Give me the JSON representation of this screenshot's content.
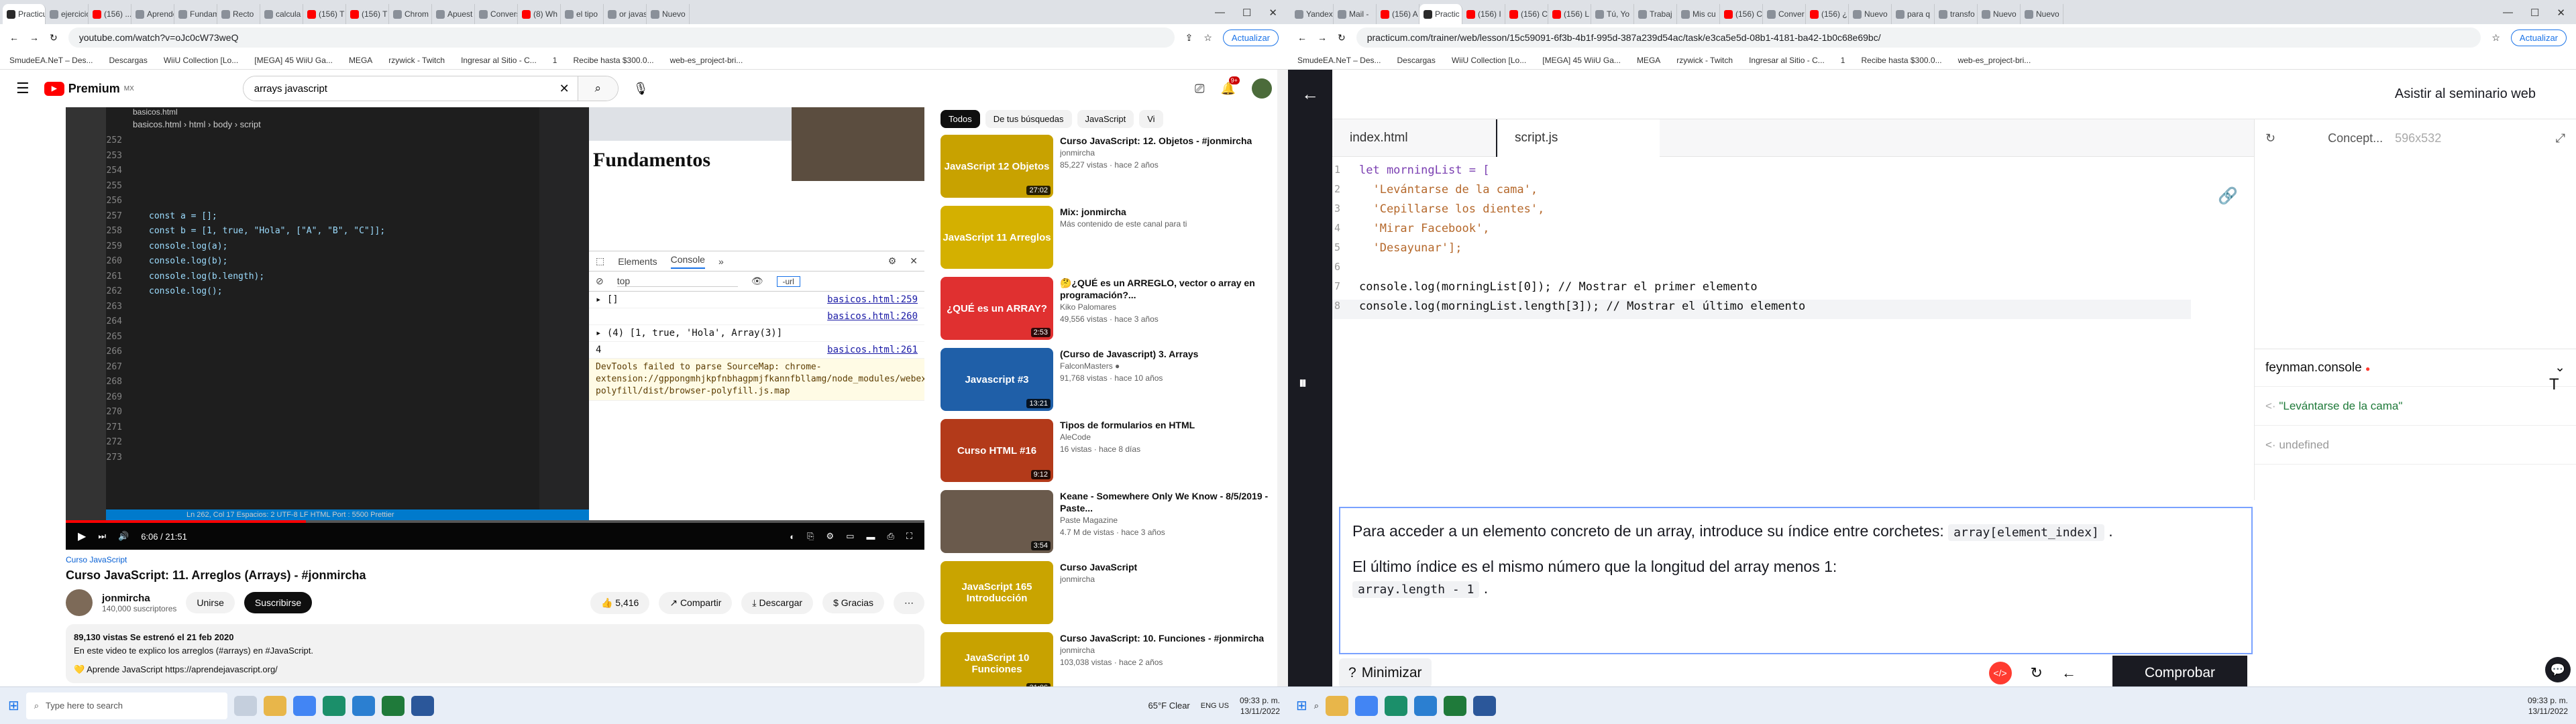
{
  "left": {
    "tabs": [
      "Practicu",
      "ejercicio",
      "(156) ...",
      "Aprende",
      "Fundam",
      "Recto",
      "calcula",
      "(156) T",
      "(156) T",
      "Chrom",
      "Apuest",
      "Convers",
      "(8) Wh",
      "el tipo",
      "or javas",
      "Nuevo"
    ],
    "url": "youtube.com/watch?v=oJc0cW73weQ",
    "update_label": "Actualizar",
    "bookmarks": [
      "SmudeEA.NeT – Des...",
      "Descargas",
      "WiiU Collection [Lo...",
      "[MEGA] 45 WiiU Ga...",
      "MEGA",
      "rzywick - Twitch",
      "Ingresar al Sitio - C...",
      "1",
      "Recibe hasta $300.0...",
      "web-es_project-bri..."
    ],
    "yt": {
      "logo": "Premium",
      "region": "MX",
      "search_value": "arrays javascript",
      "notif_count": "9+"
    },
    "vscode": {
      "title": "basicos.html",
      "crumb": "basicos.html › html › body › script",
      "lines": [
        {
          "n": "252",
          "t": ""
        },
        {
          "n": "253",
          "t": ""
        },
        {
          "n": "254",
          "t": ""
        },
        {
          "n": "255",
          "t": ""
        },
        {
          "n": "256",
          "t": ""
        },
        {
          "n": "257",
          "t": "const a = [];"
        },
        {
          "n": "258",
          "t": "const b = [1, true, \"Hola\", [\"A\", \"B\", \"C\"]];"
        },
        {
          "n": "259",
          "t": "console.log(a);"
        },
        {
          "n": "260",
          "t": "console.log(b);"
        },
        {
          "n": "261",
          "t": "console.log(b.length);"
        },
        {
          "n": "262",
          "t": "console.log();"
        },
        {
          "n": "263",
          "t": ""
        },
        {
          "n": "264",
          "t": ""
        },
        {
          "n": "265",
          "t": ""
        },
        {
          "n": "266",
          "t": ""
        },
        {
          "n": "267",
          "t": ""
        },
        {
          "n": "268",
          "t": ""
        },
        {
          "n": "269",
          "t": ""
        },
        {
          "n": "270",
          "t": ""
        },
        {
          "n": "271",
          "t": ""
        },
        {
          "n": "272",
          "t": ""
        },
        {
          "n": "273",
          "t": ""
        }
      ],
      "status": "Ln 262, Col 17   Espacios: 2   UTF-8   LF   HTML   Port : 5500   Prettier"
    },
    "page": {
      "heading": "Fundamentos"
    },
    "devtools": {
      "tabs": [
        "Elements",
        "Console"
      ],
      "context": "top",
      "filter": "-url",
      "lines": [
        {
          "text": "▸ []",
          "src": "basicos.html:259"
        },
        {
          "text": "",
          "src": "basicos.html:260"
        },
        {
          "text": "▸ (4) [1, true, 'Hola', Array(3)]",
          "src": ""
        },
        {
          "text": "4",
          "src": "basicos.html:261"
        }
      ],
      "warning": "DevTools failed to parse SourceMap: chrome-extension://gppongmhjkpfnbhagpmjfkannfbllamg/node_modules/webextension-polyfill/dist/browser-polyfill.js.map"
    },
    "player": {
      "time": "6:06 / 21:51",
      "progress": 0.28
    },
    "video": {
      "playlist": "Curso JavaScript",
      "title": "Curso JavaScript: 11. Arreglos (Arrays) - #jonmircha",
      "channel": "jonmircha",
      "subs": "140,000 suscriptores",
      "join": "Unirse",
      "subscribe": "Suscribirse",
      "likes": "5,416",
      "share": "Compartir",
      "download": "Descargar",
      "thanks": "Gracias",
      "views": "89,130 vistas  Se estrenó el 21 feb 2020",
      "desc1": "En este video te explico los arreglos (#arrays) en #JavaScript.",
      "desc2": "💛 Aprende JavaScript https://aprendejavascript.org/"
    },
    "chips": [
      "Todos",
      "De tus búsquedas",
      "JavaScript",
      "Vi"
    ],
    "sidebar": [
      {
        "thumb": "JavaScript 12 Objetos",
        "dur": "27:02",
        "title": "Curso JavaScript: 12. Objetos - #jonmircha",
        "channel": "jonmircha",
        "meta": "85,227 vistas · hace 2 años",
        "color": "#c8a200"
      },
      {
        "thumb": "JavaScript 11 Arreglos",
        "dur": "",
        "title": "Mix: jonmircha",
        "channel": "Más contenido de este canal para ti",
        "meta": "",
        "color": "#d4b000"
      },
      {
        "thumb": "¿QUÉ es un ARRAY?",
        "dur": "2:53",
        "title": "🤔¿QUÉ es un ARREGLO, vector o array en programación?...",
        "channel": "Kiko Palomares",
        "meta": "49,556 vistas · hace 3 años",
        "color": "#e03030"
      },
      {
        "thumb": "Javascript #3",
        "dur": "13:21",
        "title": "(Curso de Javascript) 3. Arrays",
        "channel": "FalconMasters ●",
        "meta": "91,768 vistas · hace 10 años",
        "color": "#1f5fa8"
      },
      {
        "thumb": "Curso HTML #16",
        "dur": "9:12",
        "title": "Tipos de formularios en HTML",
        "channel": "AleCode",
        "meta": "16 vistas · hace 8 días",
        "color": "#b33a1a"
      },
      {
        "thumb": "",
        "dur": "3:54",
        "title": "Keane - Somewhere Only We Know - 8/5/2019 - Paste...",
        "channel": "Paste Magazine",
        "meta": "4.7 M de vistas · hace 3 años",
        "color": "#6a5a4c"
      },
      {
        "thumb": "JavaScript 165 Introducción",
        "dur": "",
        "title": "Curso JavaScript",
        "channel": "jonmircha",
        "meta": "",
        "color": "#c9a400"
      },
      {
        "thumb": "JavaScript 10 Funciones",
        "dur": "31:06",
        "title": "Curso JavaScript: 10. Funciones - #jonmircha",
        "channel": "jonmircha",
        "meta": "103,038 vistas · hace 2 años",
        "color": "#c8a200"
      }
    ],
    "taskbar": {
      "search": "Type here to search",
      "weather": "65°F  Clear",
      "lang": "ENG US",
      "time": "09:33 p. m.",
      "date": "13/11/2022"
    }
  },
  "right": {
    "tabs": [
      "Yandex",
      "Mail -",
      "(156) A",
      "Practic",
      "(156) I",
      "(156) C",
      "(156) L",
      "Tú, Yo",
      "Trabaj",
      "Mis cu",
      "(156) C",
      "Conver",
      "(156) ¿",
      "Nuevo",
      "para q",
      "transfo",
      "Nuevo",
      "Nuevo"
    ],
    "url": "practicum.com/trainer/web/lesson/15c59091-6f3b-4b1f-995d-387a239d54ac/task/e3ca5e5d-08b1-4181-ba42-1b0c68e69bc/",
    "update_label": "Actualizar",
    "header_title": "Asistir al seminario web",
    "file_tabs": [
      "index.html",
      "script.js"
    ],
    "code_lines": [
      {
        "n": "1",
        "t": "let morningList = ["
      },
      {
        "n": "2",
        "t": "  'Levántarse de la cama',"
      },
      {
        "n": "3",
        "t": "  'Cepillarse los dientes',"
      },
      {
        "n": "4",
        "t": "  'Mirar Facebook',"
      },
      {
        "n": "5",
        "t": "  'Desayunar'];"
      },
      {
        "n": "6",
        "t": ""
      },
      {
        "n": "7",
        "t": "console.log(morningList[0]); // Mostrar el primer elemento"
      },
      {
        "n": "8",
        "t": "console.log(morningList.length[3]); // Mostrar el último elemento"
      }
    ],
    "preview": {
      "label": "Concept...",
      "dims": "596x532"
    },
    "console": {
      "title": "feynman.console",
      "lines": [
        "\"Levántarse de la cama\"",
        "undefined"
      ]
    },
    "theory": {
      "p1a": "Para acceder a un elemento concreto de un array, introduce su índice entre corchetes:",
      "code1": "array[element_index]",
      "p2": "El último índice es el mismo número que la longitud del array menos 1:",
      "code2": "array.length - 1"
    },
    "minimize": "Minimizar",
    "check": "Comprobar",
    "taskbar": {
      "time": "09:33 p. m.",
      "date": "13/11/2022"
    }
  }
}
